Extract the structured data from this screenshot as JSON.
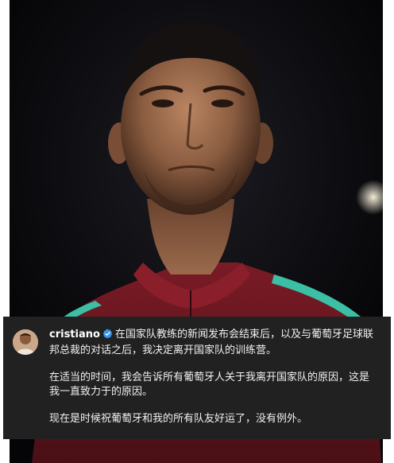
{
  "post": {
    "username": "cristiano",
    "verified": true,
    "caption_paragraphs": [
      "在国家队教练的新闻发布会结束后，以及与葡萄牙足球联邦总裁的对话之后，我决定离开国家队的训练营。",
      "在适当的时间，我会告诉所有葡萄牙人关于我离开国家队的原因，这是我一直致力于的原因。",
      "现在是时候祝葡萄牙和我的所有队友好运了，没有例外。"
    ]
  },
  "colors": {
    "caption_background": "#212121",
    "verified_badge": "#3897f0",
    "jersey": "#6b1620",
    "jersey_trim": "#3bbfa5"
  },
  "icons": {
    "verified": "verified-badge-icon",
    "avatar": "profile-avatar"
  }
}
